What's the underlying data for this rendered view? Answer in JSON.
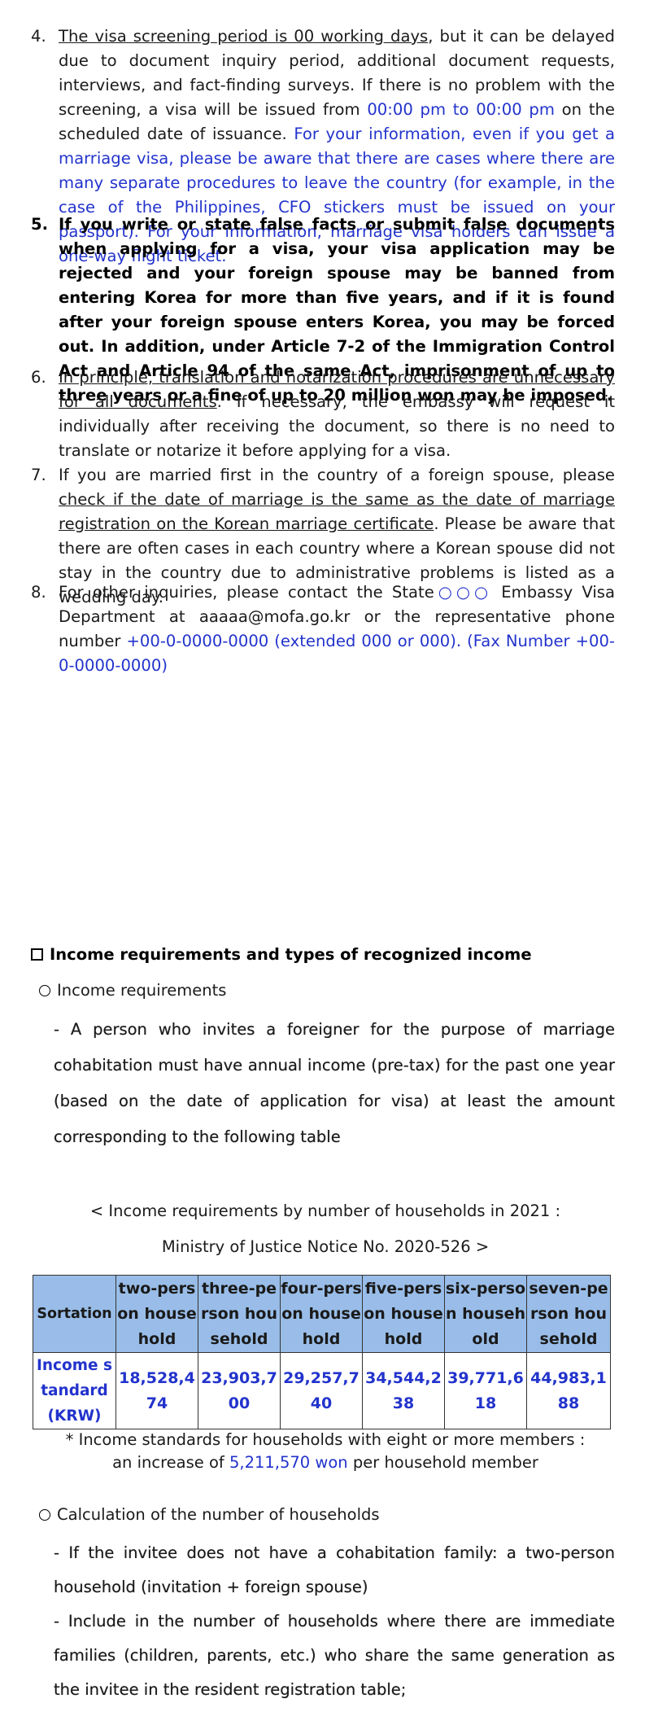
{
  "items": {
    "item4": {
      "number": "4.",
      "underlined_lead": "The visa screening period is 00 working days",
      "text_a": ", but it can be delayed due to document inquiry period, additional document requests, interviews, and fact-finding surveys. If there is no problem with the screening, a visa will be issued from ",
      "time_range": "00:00 pm to 00:00 pm",
      "text_b": " on the scheduled date of issuance. ",
      "blue_note": "For your information, even if you get a marriage visa, please be aware that there are cases where there are many separate procedures to leave the country (for example, in the case of the Philippines, CFO stickers must be issued on your passport). For your information, marriage visa holders can issue a one-way flight ticket."
    },
    "item5": {
      "number": "5.",
      "text": "If you write or state false facts or submit false documents when applying for a visa, your visa application may be rejected and your foreign spouse may be banned from entering Korea for more than five years, and if it is found after your foreign spouse enters Korea, you may be forced out. In addition, under Article 7-2 of the Immigration Control Act and Article 94 of the same Act, imprisonment of up to three years or a fine of up to 20 million won may be imposed."
    },
    "item6": {
      "number": "6.",
      "underlined_lead": "In principle, translation and notarization procedures are unnecessary for all documents",
      "text": ". If necessary, the embassy will request it individually after receiving the document, so there is no need to translate or notarize it before applying for a visa."
    },
    "item7": {
      "number": "7.",
      "text_a": "If you are married first in the country of a foreign spouse, please ",
      "underlined": "check if the date of marriage is the same as the date of marriage registration on the Korean marriage certificate",
      "text_b": ". Please be aware that there are often cases in each country where a Korean spouse did not stay in the country due to administrative problems is listed as a wedding day."
    },
    "item8": {
      "number": "8.",
      "text_a": "For other inquiries, please contact the State",
      "circles": "○○○",
      "text_b": " Embassy Visa Department at aaaaa@mofa.go.kr or the representative phone number ",
      "blue_contact": "+00-0-0000-0000 (extended 000 or 000). (Fax Number +00-0-0000-0000)"
    }
  },
  "income_section": {
    "heading": "Income requirements and types of recognized income",
    "sub1_title": "Income requirements",
    "sub1_text": "- A person who invites a foreigner for the purpose of marriage cohabitation must have annual income (pre-tax) for the past one year (based on the date of application for visa) at least the amount corresponding to the following table",
    "caption_line1": "< Income requirements by number of households in 2021 :",
    "caption_line2": "Ministry of Justice Notice No. 2020-526 >",
    "table": {
      "header_first": "Sortation",
      "headers": [
        "two-person household",
        "three-person household",
        "four-person household",
        "five-person household",
        "six-person household",
        "seven-person household"
      ],
      "row_label": "Income standard (KRW)",
      "values": [
        "18,528,474",
        "23,903,700",
        "29,257,740",
        "34,544,238",
        "39,771,618",
        "44,983,188"
      ]
    },
    "note_line1": "* Income standards for households with eight or more members :",
    "note_line2_a": "an increase of ",
    "note_increase": "5,211,570 won",
    "note_line2_b": " per household member",
    "sub2_title": "Calculation of the number of households",
    "sub2_text1": "- If the invitee does not have a cohabitation family: a two-person household (invitation + foreign spouse)",
    "sub2_text2": "- Include in the number of households where there are immediate families (children, parents, etc.) who share the same generation as the invitee in the resident registration table;"
  },
  "colors": {
    "accent_blue": "#2233cc",
    "table_header": "#99bde8"
  }
}
